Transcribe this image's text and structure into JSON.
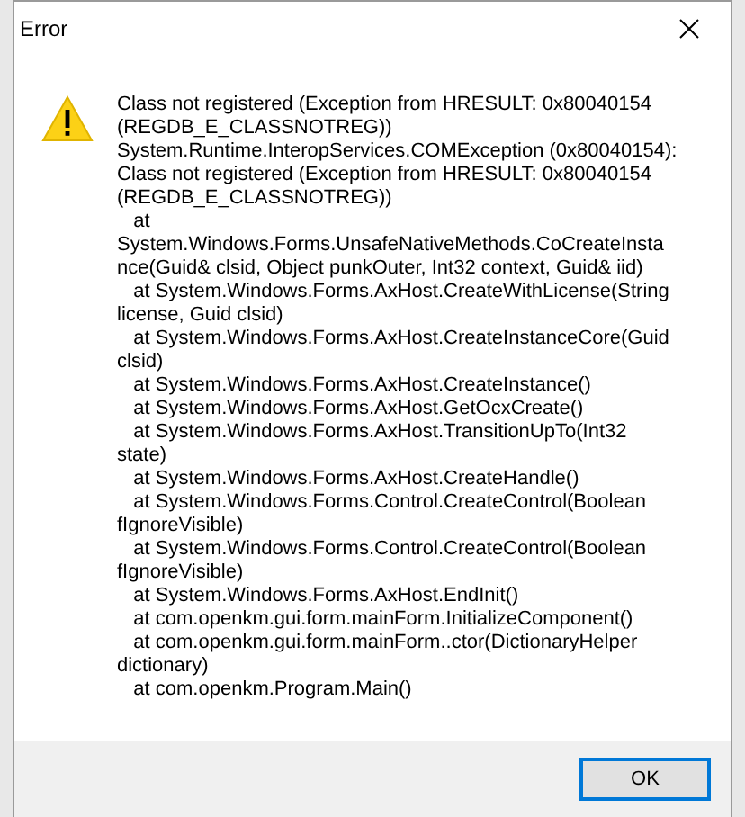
{
  "window": {
    "title": "Error"
  },
  "message_lines": [
    "Class not registered (Exception from HRESULT: 0x80040154",
    "(REGDB_E_CLASSNOTREG))",
    "System.Runtime.InteropServices.COMException (0x80040154):",
    "Class not registered (Exception from HRESULT: 0x80040154",
    "(REGDB_E_CLASSNOTREG))",
    "   at",
    "System.Windows.Forms.UnsafeNativeMethods.CoCreateInsta",
    "nce(Guid& clsid, Object punkOuter, Int32 context, Guid& iid)",
    "   at System.Windows.Forms.AxHost.CreateWithLicense(String",
    "license, Guid clsid)",
    "   at System.Windows.Forms.AxHost.CreateInstanceCore(Guid",
    "clsid)",
    "   at System.Windows.Forms.AxHost.CreateInstance()",
    "   at System.Windows.Forms.AxHost.GetOcxCreate()",
    "   at System.Windows.Forms.AxHost.TransitionUpTo(Int32",
    "state)",
    "   at System.Windows.Forms.AxHost.CreateHandle()",
    "   at System.Windows.Forms.Control.CreateControl(Boolean",
    "fIgnoreVisible)",
    "   at System.Windows.Forms.Control.CreateControl(Boolean",
    "fIgnoreVisible)",
    "   at System.Windows.Forms.AxHost.EndInit()",
    "   at com.openkm.gui.form.mainForm.InitializeComponent()",
    "   at com.openkm.gui.form.mainForm..ctor(DictionaryHelper",
    "dictionary)",
    "   at com.openkm.Program.Main()"
  ],
  "buttons": [
    "OK"
  ]
}
